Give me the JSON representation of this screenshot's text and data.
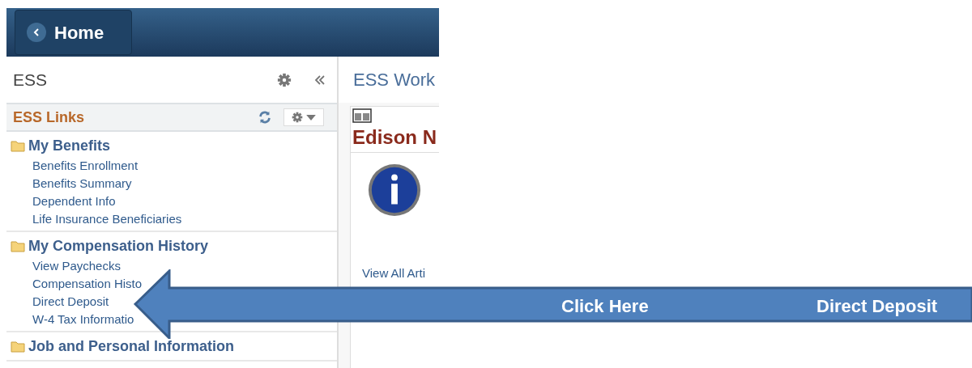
{
  "header": {
    "home_button": "Home"
  },
  "sidebar": {
    "title": "ESS",
    "pagelet_title": "ESS Links",
    "groups": [
      {
        "title": "My Benefits",
        "links": [
          "Benefits Enrollment",
          "Benefits Summary",
          "Dependent Info",
          "Life Insurance Beneficiaries"
        ]
      },
      {
        "title": "My Compensation History",
        "links": [
          "View Paychecks",
          "Compensation Histo",
          "Direct Deposit",
          "W-4 Tax Informatio"
        ]
      },
      {
        "title": "Job and Personal Information"
      }
    ]
  },
  "main": {
    "title": "ESS Work",
    "pagelet_title": "Edison N",
    "link": "View All Arti"
  },
  "callout": {
    "label": "Click Here",
    "target": "Direct Deposit"
  }
}
